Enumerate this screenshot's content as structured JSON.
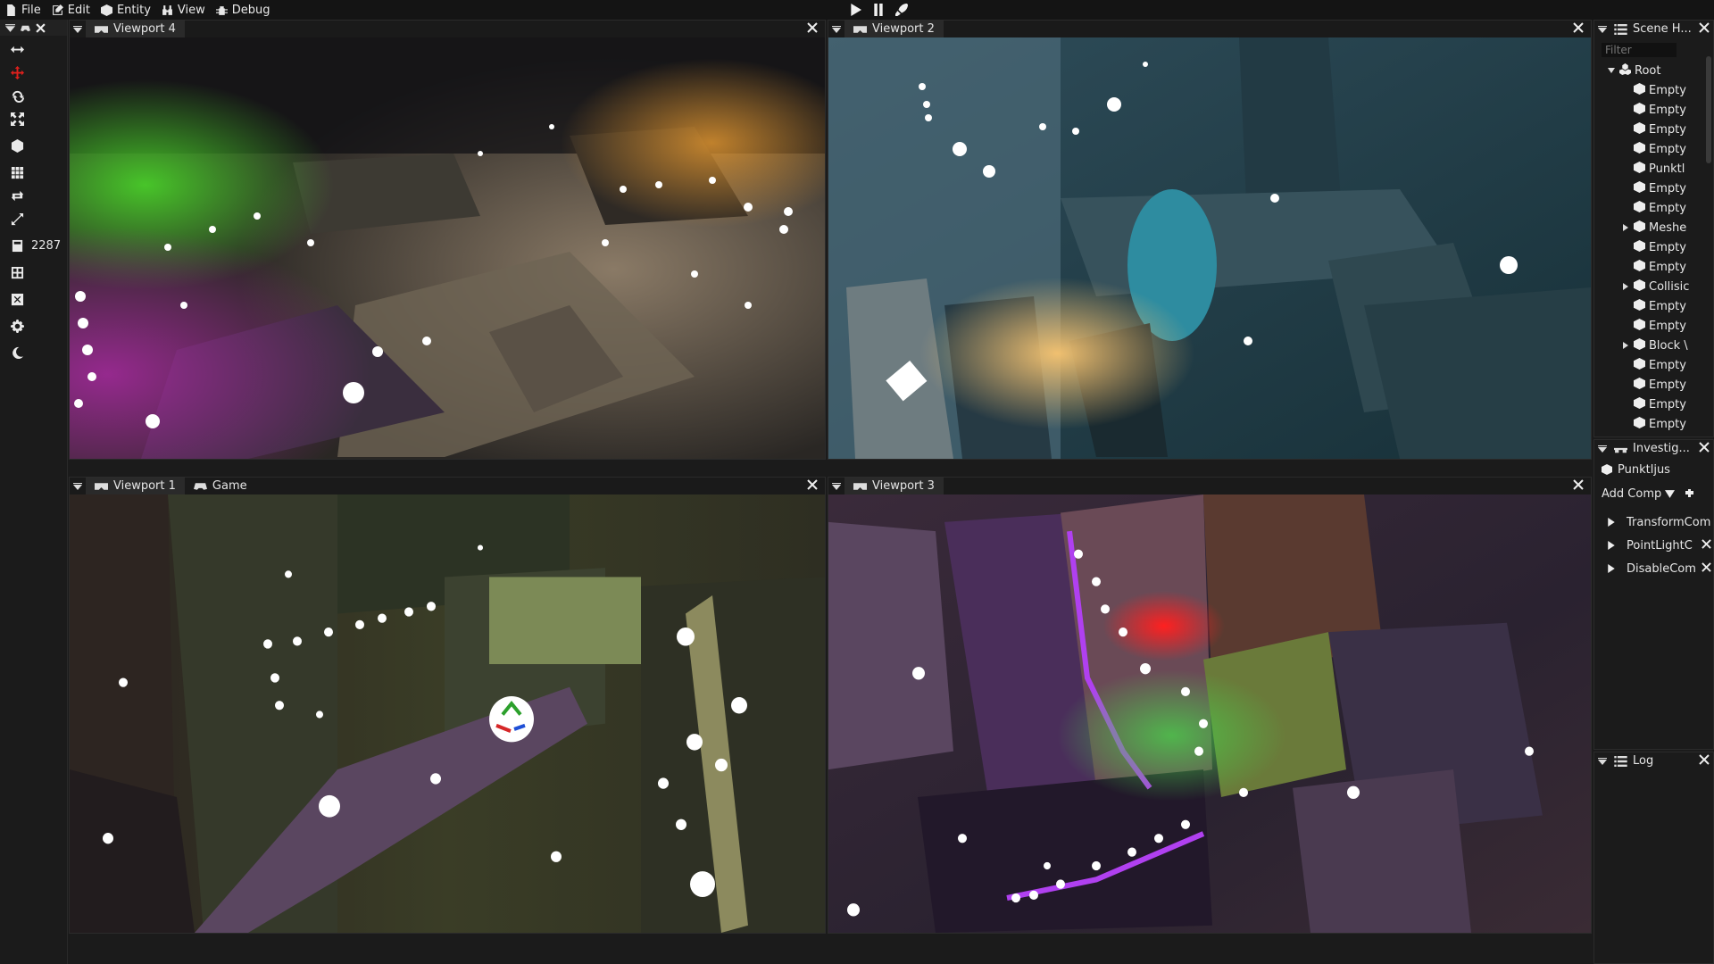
{
  "menu": {
    "file": "File",
    "edit": "Edit",
    "entity": "Entity",
    "view": "View",
    "debug": "Debug"
  },
  "toolbar": {
    "entity_count": "2287"
  },
  "viewports": {
    "v4": {
      "title": "Viewport 4"
    },
    "v2": {
      "title": "Viewport 2"
    },
    "v1": {
      "title": "Viewport 1",
      "second_tab": "Game"
    },
    "v3": {
      "title": "Viewport 3"
    }
  },
  "scene_hierarchy": {
    "title": "Scene H...",
    "filter_placeholder": "Filter",
    "root": "Root",
    "items": [
      {
        "label": "Empty",
        "expandable": false
      },
      {
        "label": "Empty",
        "expandable": false
      },
      {
        "label": "Empty",
        "expandable": false
      },
      {
        "label": "Empty",
        "expandable": false
      },
      {
        "label": "Punktl",
        "expandable": false
      },
      {
        "label": "Empty",
        "expandable": false
      },
      {
        "label": "Empty",
        "expandable": false
      },
      {
        "label": "Meshe",
        "expandable": true
      },
      {
        "label": "Empty",
        "expandable": false
      },
      {
        "label": "Empty",
        "expandable": false
      },
      {
        "label": "Collisic",
        "expandable": true
      },
      {
        "label": "Empty",
        "expandable": false
      },
      {
        "label": "Empty",
        "expandable": false
      },
      {
        "label": "Block \\",
        "expandable": true
      },
      {
        "label": "Empty",
        "expandable": false
      },
      {
        "label": "Empty",
        "expandable": false
      },
      {
        "label": "Empty",
        "expandable": false
      },
      {
        "label": "Empty",
        "expandable": false
      }
    ]
  },
  "inspector": {
    "title": "Investig...",
    "entity_name": "Punktljus",
    "add_component": "Add Comp",
    "components": [
      "TransformCom",
      "PointLightC",
      "DisableCom"
    ]
  },
  "log": {
    "title": "Log"
  }
}
